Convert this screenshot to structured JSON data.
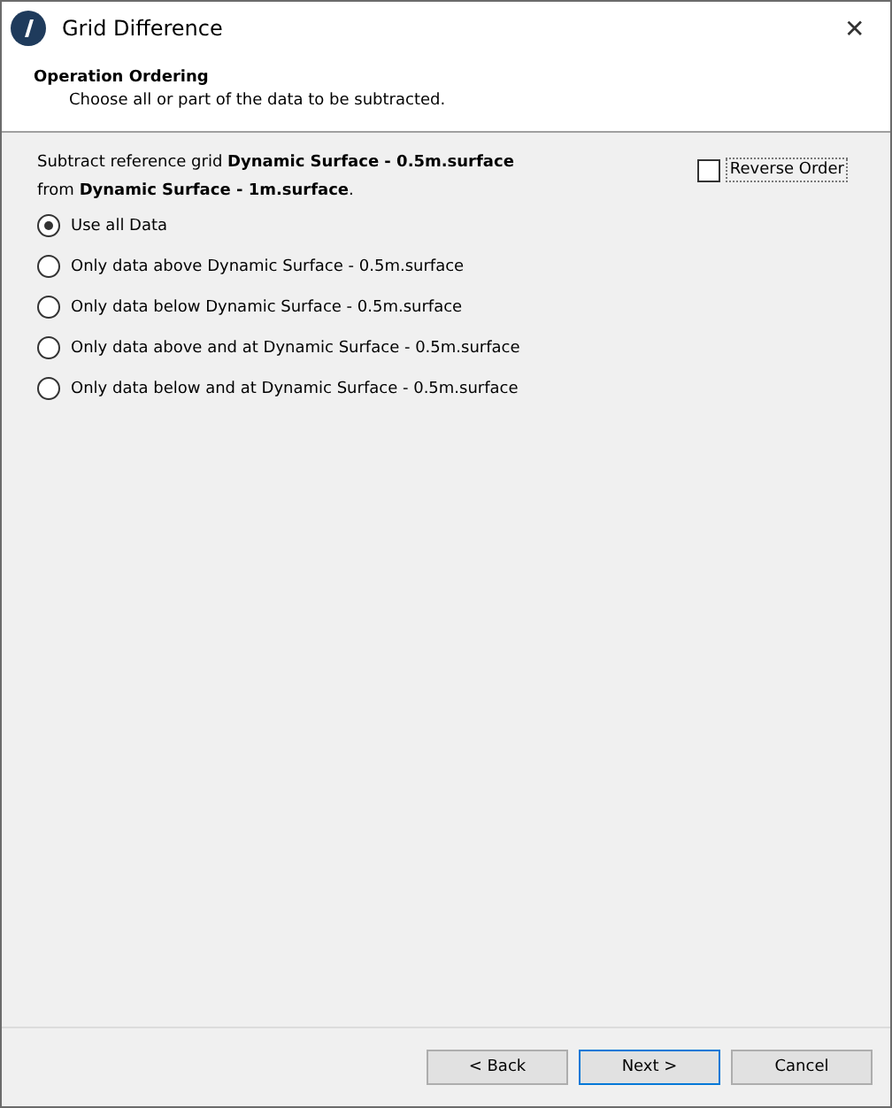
{
  "window": {
    "title": "Grid Difference",
    "close": "✕"
  },
  "header": {
    "title": "Operation Ordering",
    "subtitle": "Choose all or part of the data to be subtracted."
  },
  "description": [
    "Subtract reference grid **Dynamic Surface - 0.5m.surface**",
    "from **Dynamic Surface - 1m.surface**."
  ],
  "reverse_order": {
    "label": "Reverse Order",
    "checked": false
  },
  "options": [
    {
      "label": "Use all Data",
      "selected": true
    },
    {
      "label": "Only data above Dynamic Surface - 0.5m.surface",
      "selected": false
    },
    {
      "label": "Only data below Dynamic Surface - 0.5m.surface",
      "selected": false
    },
    {
      "label": "Only data above and at Dynamic Surface - 0.5m.surface",
      "selected": false
    },
    {
      "label": "Only data below and at Dynamic Surface - 0.5m.surface",
      "selected": false
    }
  ],
  "buttons": [
    {
      "label": "< Back",
      "default": false
    },
    {
      "label": "Next >",
      "default": true
    },
    {
      "label": "Cancel",
      "default": false
    }
  ]
}
